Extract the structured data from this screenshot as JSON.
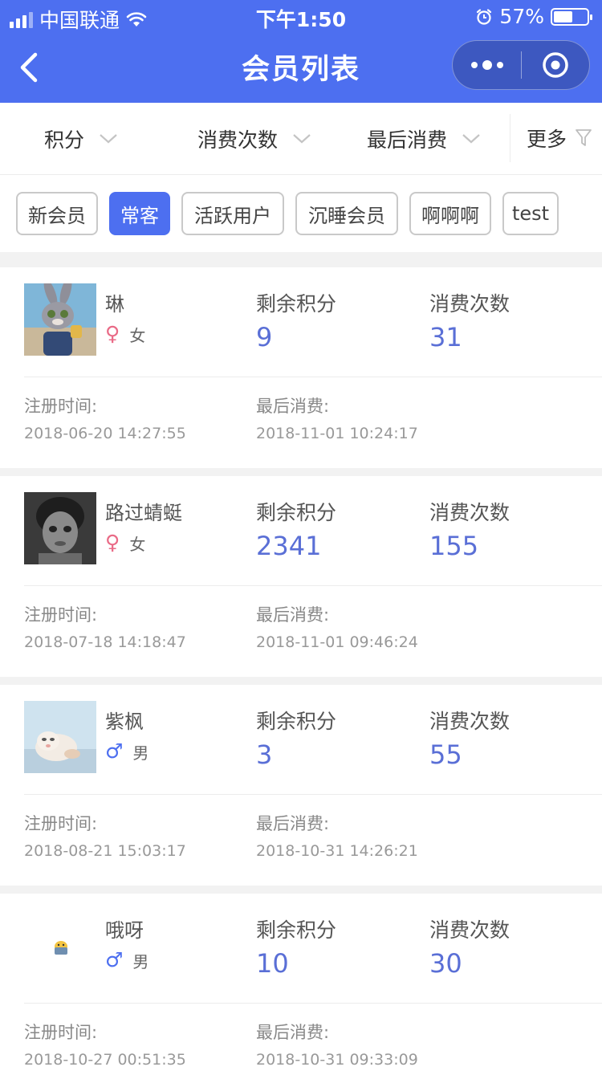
{
  "status_bar": {
    "carrier": "中国联通",
    "time": "下午1:50",
    "battery": "57%",
    "battery_level": 0.57
  },
  "nav": {
    "title": "会员列表"
  },
  "filters": [
    {
      "label": "积分"
    },
    {
      "label": "消费次数"
    },
    {
      "label": "最后消费"
    }
  ],
  "filter_more": "更多",
  "tags": [
    "新会员",
    "常客",
    "活跃用户",
    "沉睡会员",
    "啊啊啊",
    "test"
  ],
  "active_tag": "常客",
  "labels": {
    "points": "剩余积分",
    "count": "消费次数",
    "registered": "注册时间:",
    "last": "最后消费:"
  },
  "colors": {
    "brand": "#4d6ff0",
    "female": "#e96a86",
    "value": "#5a6fd6"
  },
  "members": [
    {
      "name": "琳",
      "gender_symbol": "♀",
      "gender": "女",
      "points": "9",
      "count": "31",
      "registered": "2018-06-20 14:27:55",
      "last": "2018-11-01 10:24:17",
      "avatar": "rabbit-cop-avatar"
    },
    {
      "name": "路过蜻蜓",
      "gender_symbol": "♀",
      "gender": "女",
      "points": "2341",
      "count": "155",
      "registered": "2018-07-18 14:18:47",
      "last": "2018-11-01 09:46:24",
      "avatar": "child-photo-avatar"
    },
    {
      "name": "紫枫",
      "gender_symbol": "♂",
      "gender": "男",
      "points": "3",
      "count": "55",
      "registered": "2018-08-21 15:03:17",
      "last": "2018-10-31 14:26:21",
      "avatar": "kitten-photo-avatar"
    },
    {
      "name": "哦呀",
      "gender_symbol": "♂",
      "gender": "男",
      "points": "10",
      "count": "30",
      "registered": "2018-10-27 00:51:35",
      "last": "2018-10-31 09:33:09",
      "avatar": "small-sticker-avatar"
    }
  ]
}
